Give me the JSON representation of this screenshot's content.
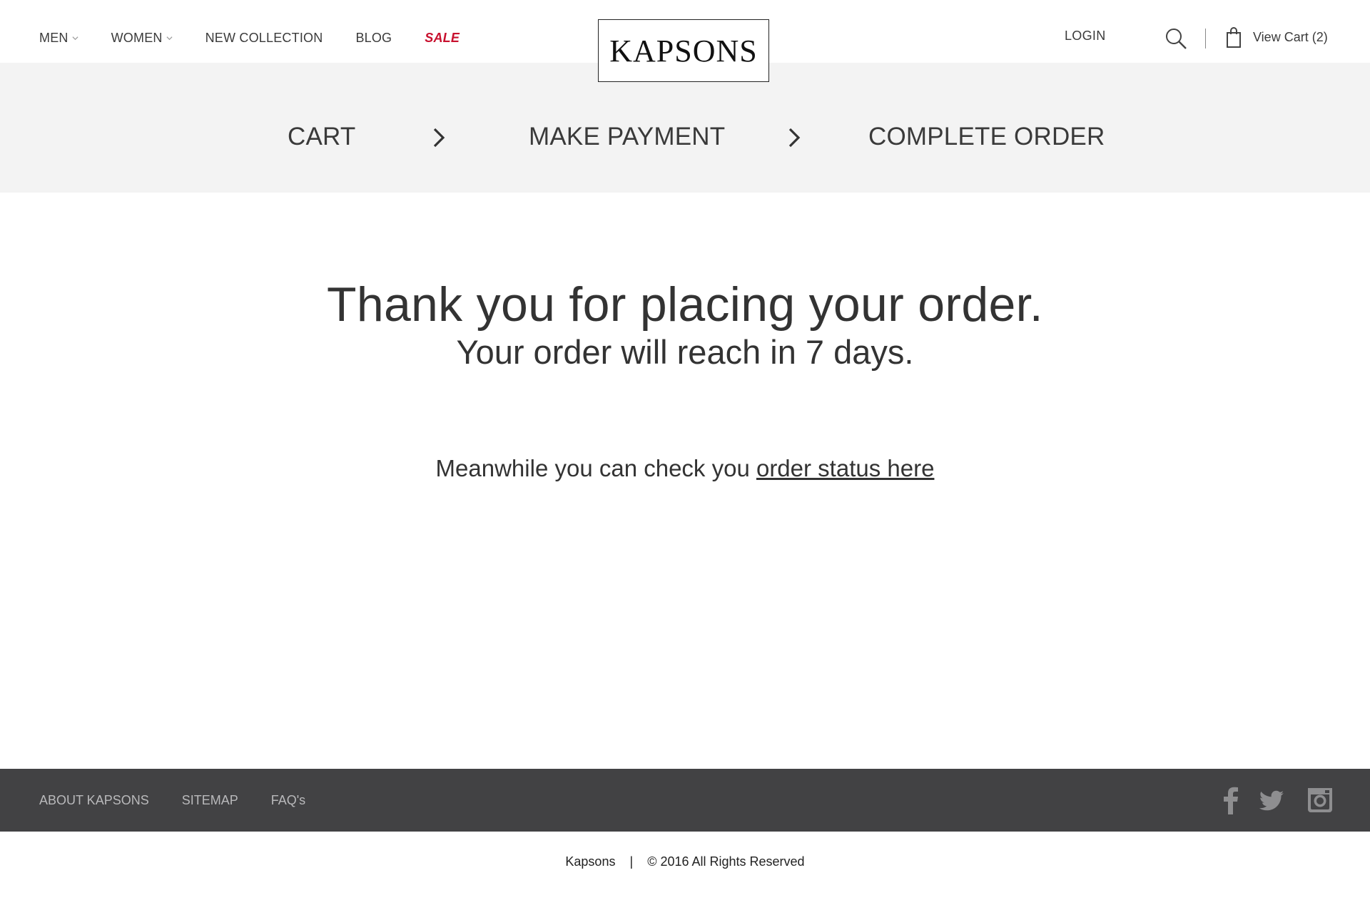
{
  "header": {
    "nav": {
      "men": "MEN",
      "women": "WOMEN",
      "new_collection": "NEW COLLECTION",
      "blog": "BLOG",
      "sale": "SALE"
    },
    "logo": "KAPSONS",
    "login": "LOGIN",
    "view_cart": "View Cart (2)",
    "icons": {
      "search": "search-icon",
      "cart": "shopping-bag-icon",
      "dropdown": "chevron-down-icon"
    }
  },
  "steps": {
    "cart": "CART",
    "make_payment": "MAKE PAYMENT",
    "complete_order": "COMPLETE ORDER",
    "separator_icon": "chevron-right-icon"
  },
  "main": {
    "thanks": "Thank you for placing your order.",
    "reach": "Your order will reach in 7 days.",
    "meanwhile": "Meanwhile you can check you ",
    "status_link": "order status here"
  },
  "footer": {
    "links": {
      "about": "ABOUT KAPSONS",
      "sitemap": "SITEMAP",
      "faqs": "FAQ's"
    },
    "social_icons": [
      "facebook-icon",
      "twitter-icon",
      "instagram-icon"
    ],
    "copyright_brand": "Kapsons",
    "copyright_sep": "|",
    "copyright_text": "© 2016 All Rights Reserved"
  },
  "colors": {
    "sale": "#c8102e",
    "steps_bg": "#f3f3f3",
    "footer_bg": "#424244",
    "footer_text": "#b9b9bb"
  }
}
